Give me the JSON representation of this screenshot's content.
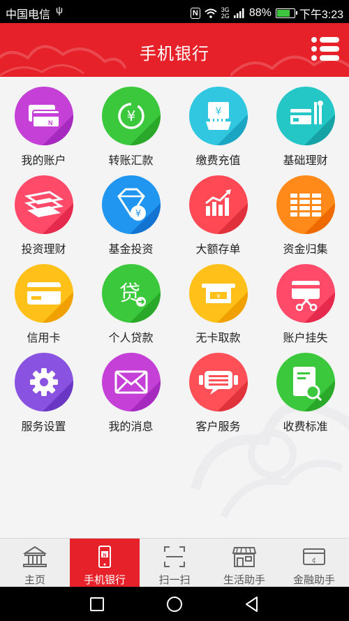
{
  "status_bar": {
    "carrier": "中国电信",
    "usb_icon": "usb-icon",
    "nfc": "N",
    "network_top": "3G",
    "network_bottom": "2G",
    "battery": "88%",
    "time": "下午3:23"
  },
  "header": {
    "title": "手机银行",
    "menu_icon": "list-menu-icon",
    "color": "#e62129"
  },
  "grid": [
    {
      "label": "我的账户",
      "icon": "cards-icon",
      "colors": [
        "#c440d6",
        "#a62ac0"
      ]
    },
    {
      "label": "转账汇款",
      "icon": "yen-transfer-icon",
      "colors": [
        "#3cc83c",
        "#29a829"
      ]
    },
    {
      "label": "缴费充值",
      "icon": "hand-bill-icon",
      "colors": [
        "#32c7e0",
        "#1aa5c2"
      ]
    },
    {
      "label": "基础理财",
      "icon": "card-tools-icon",
      "colors": [
        "#24c7c6",
        "#16a3a6"
      ]
    },
    {
      "label": "投资理财",
      "icon": "stacked-bills-icon",
      "colors": [
        "#ff4a6a",
        "#e62a4d"
      ]
    },
    {
      "label": "基金投资",
      "icon": "diamond-yen-icon",
      "colors": [
        "#2196f0",
        "#1273d0"
      ]
    },
    {
      "label": "大额存单",
      "icon": "growth-chart-icon",
      "colors": [
        "#ff4a55",
        "#e0303c"
      ]
    },
    {
      "label": "资金归集",
      "icon": "money-stacks-icon",
      "colors": [
        "#ff8a1a",
        "#ee6a00"
      ]
    },
    {
      "label": "信用卡",
      "icon": "credit-card-icon",
      "colors": [
        "#ffc01a",
        "#f0a000"
      ]
    },
    {
      "label": "个人贷款",
      "icon": "loan-icon",
      "colors": [
        "#3cc83c",
        "#29a829"
      ]
    },
    {
      "label": "无卡取款",
      "icon": "atm-icon",
      "colors": [
        "#ffc01a",
        "#f0a000"
      ]
    },
    {
      "label": "账户挂失",
      "icon": "card-cut-icon",
      "colors": [
        "#ff4a6a",
        "#e62a4d"
      ]
    },
    {
      "label": "服务设置",
      "icon": "gear-icon",
      "colors": [
        "#8a52e0",
        "#6a36c4"
      ]
    },
    {
      "label": "我的消息",
      "icon": "envelope-icon",
      "colors": [
        "#c440d6",
        "#a62ac0"
      ]
    },
    {
      "label": "客户服务",
      "icon": "chat-service-icon",
      "colors": [
        "#ff5058",
        "#e0333c"
      ]
    },
    {
      "label": "收费标准",
      "icon": "document-search-icon",
      "colors": [
        "#3cc83c",
        "#29a829"
      ]
    }
  ],
  "tabs": [
    {
      "label": "主页",
      "icon": "bank-building-icon",
      "active": false
    },
    {
      "label": "手机银行",
      "icon": "mobile-phone-icon",
      "active": true
    },
    {
      "label": "扫一扫",
      "icon": "scan-icon",
      "active": false
    },
    {
      "label": "生活助手",
      "icon": "storefront-icon",
      "active": false
    },
    {
      "label": "金融助手",
      "icon": "finance-card-icon",
      "active": false
    }
  ],
  "nav_bar": {
    "recent": "square-icon",
    "home": "circle-icon",
    "back": "triangle-back-icon"
  }
}
